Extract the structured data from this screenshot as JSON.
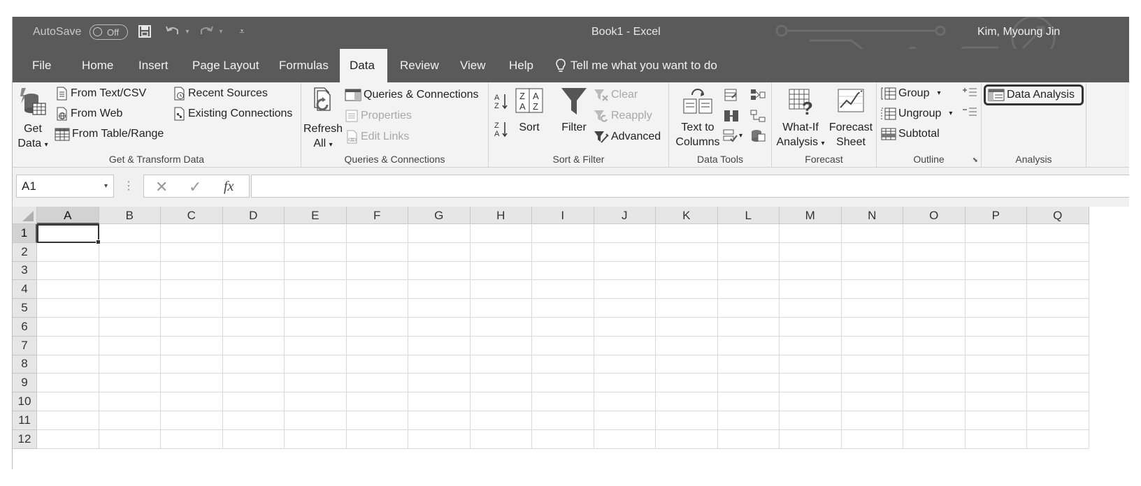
{
  "window": {
    "autosave_label": "AutoSave",
    "autosave_state": "Off",
    "title": "Book1  -  Excel",
    "user": "Kim, Myoung Jin"
  },
  "tabs": [
    "File",
    "Home",
    "Insert",
    "Page Layout",
    "Formulas",
    "Data",
    "Review",
    "View",
    "Help"
  ],
  "active_tab": "Data",
  "tell_me": "Tell me what you want to do",
  "ribbon": {
    "get_transform": {
      "label": "Get & Transform Data",
      "get_data_line1": "Get",
      "get_data_line2": "Data",
      "from_text_csv": "From Text/CSV",
      "from_web": "From Web",
      "from_table_range": "From Table/Range",
      "recent_sources": "Recent Sources",
      "existing_connections": "Existing Connections"
    },
    "queries": {
      "label": "Queries & Connections",
      "refresh_line1": "Refresh",
      "refresh_line2": "All",
      "queries_connections": "Queries & Connections",
      "properties": "Properties",
      "edit_links": "Edit Links"
    },
    "sort_filter": {
      "label": "Sort & Filter",
      "sort": "Sort",
      "filter": "Filter",
      "clear": "Clear",
      "reapply": "Reapply",
      "advanced": "Advanced"
    },
    "data_tools": {
      "label": "Data Tools",
      "text_to_columns_line1": "Text to",
      "text_to_columns_line2": "Columns"
    },
    "forecast": {
      "label": "Forecast",
      "what_if_line1": "What-If",
      "what_if_line2": "Analysis",
      "forecast_sheet_line1": "Forecast",
      "forecast_sheet_line2": "Sheet"
    },
    "outline": {
      "label": "Outline",
      "group": "Group",
      "ungroup": "Ungroup",
      "subtotal": "Subtotal"
    },
    "analysis": {
      "label": "Analysis",
      "data_analysis": "Data Analysis"
    }
  },
  "formula_bar": {
    "name_box": "A1",
    "fx": "fx",
    "value": ""
  },
  "sheet": {
    "columns": [
      "A",
      "B",
      "C",
      "D",
      "E",
      "F",
      "G",
      "H",
      "I",
      "J",
      "K",
      "L",
      "M",
      "N",
      "O",
      "P",
      "Q"
    ],
    "rows": [
      "1",
      "2",
      "3",
      "4",
      "5",
      "6",
      "7",
      "8",
      "9",
      "10",
      "11",
      "12"
    ],
    "active_cell": "A1"
  }
}
